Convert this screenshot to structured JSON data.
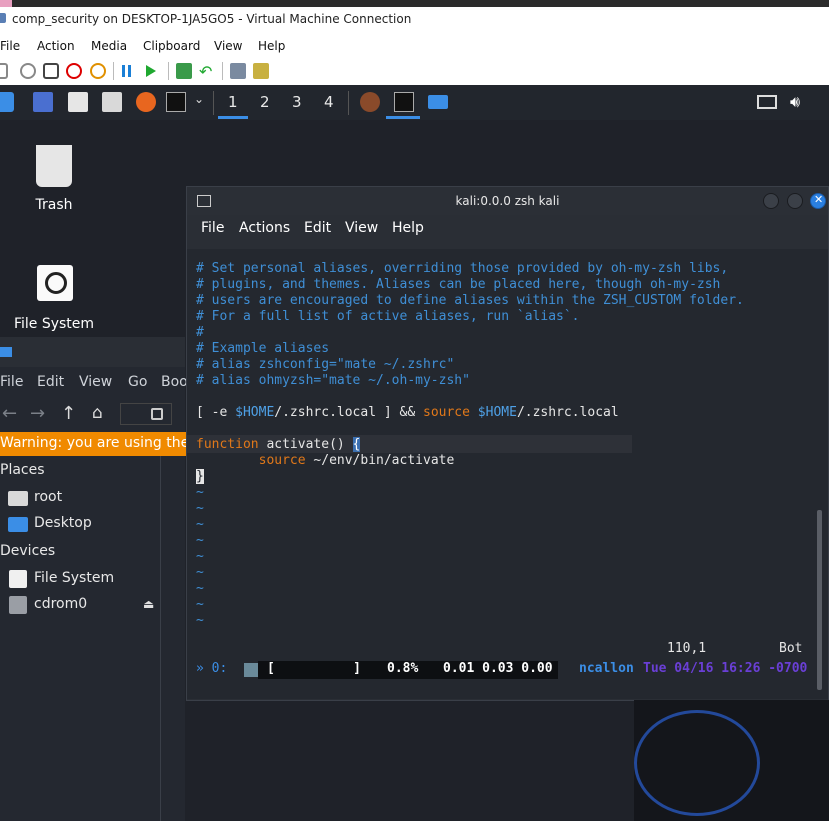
{
  "host": {
    "window_title": "comp_security on DESKTOP-1JA5GO5 - Virtual Machine Connection",
    "menu": [
      "File",
      "Action",
      "Media",
      "Clipboard",
      "View",
      "Help"
    ]
  },
  "panel": {
    "workspaces": [
      "1",
      "2",
      "3",
      "4"
    ]
  },
  "desktop": {
    "icons": [
      {
        "label": "Trash"
      },
      {
        "label": "File System"
      }
    ]
  },
  "file_manager": {
    "menu": [
      "File",
      "Edit",
      "View",
      "Go",
      "Boo"
    ],
    "warning": "Warning: you are using the ro",
    "places_header": "Places",
    "places": [
      "root",
      "Desktop"
    ],
    "devices_header": "Devices",
    "devices": [
      "File System",
      "cdrom0"
    ]
  },
  "terminal": {
    "title": "kali:0.0.0 zsh kali",
    "menu": [
      "File",
      "Actions",
      "Edit",
      "View",
      "Help"
    ],
    "comments": [
      "# Set personal aliases, overriding those provided by oh-my-zsh libs,",
      "# plugins, and themes. Aliases can be placed here, though oh-my-zsh",
      "# users are encouraged to define aliases within the ZSH_CUSTOM folder.",
      "# For a full list of active aliases, run `alias`.",
      "#",
      "# Example aliases",
      "# alias zshconfig=\"mate ~/.zshrc\"",
      "# alias ohmyzsh=\"mate ~/.oh-my-zsh\""
    ],
    "source_line": {
      "p1": "[ -e ",
      "p2": "$HOME",
      "p3": "/.zshrc.local ] && ",
      "p4": "source ",
      "p5": "$HOME",
      "p6": "/.zshrc.local"
    },
    "func_line": {
      "kw": "function",
      "name": " activate() ",
      "brace": "{"
    },
    "func_body": {
      "kw": "source",
      "arg": " ~/env/bin/activate"
    },
    "close_brace": "}",
    "tilde": "~",
    "position": "110,1",
    "scroll": "Bot",
    "status": {
      "pane": "» 0:",
      "bar": "[          ]",
      "pct": "0.8%",
      "load": "0.01 0.03 0.00",
      "user": "ncallon",
      "date": "Tue 04/16 16:26 -0700"
    }
  },
  "colors": {
    "comment": "#3f8fd6",
    "keyword": "#e0781a",
    "warning_bg": "#f08a00",
    "accent": "#3b8ee6"
  }
}
